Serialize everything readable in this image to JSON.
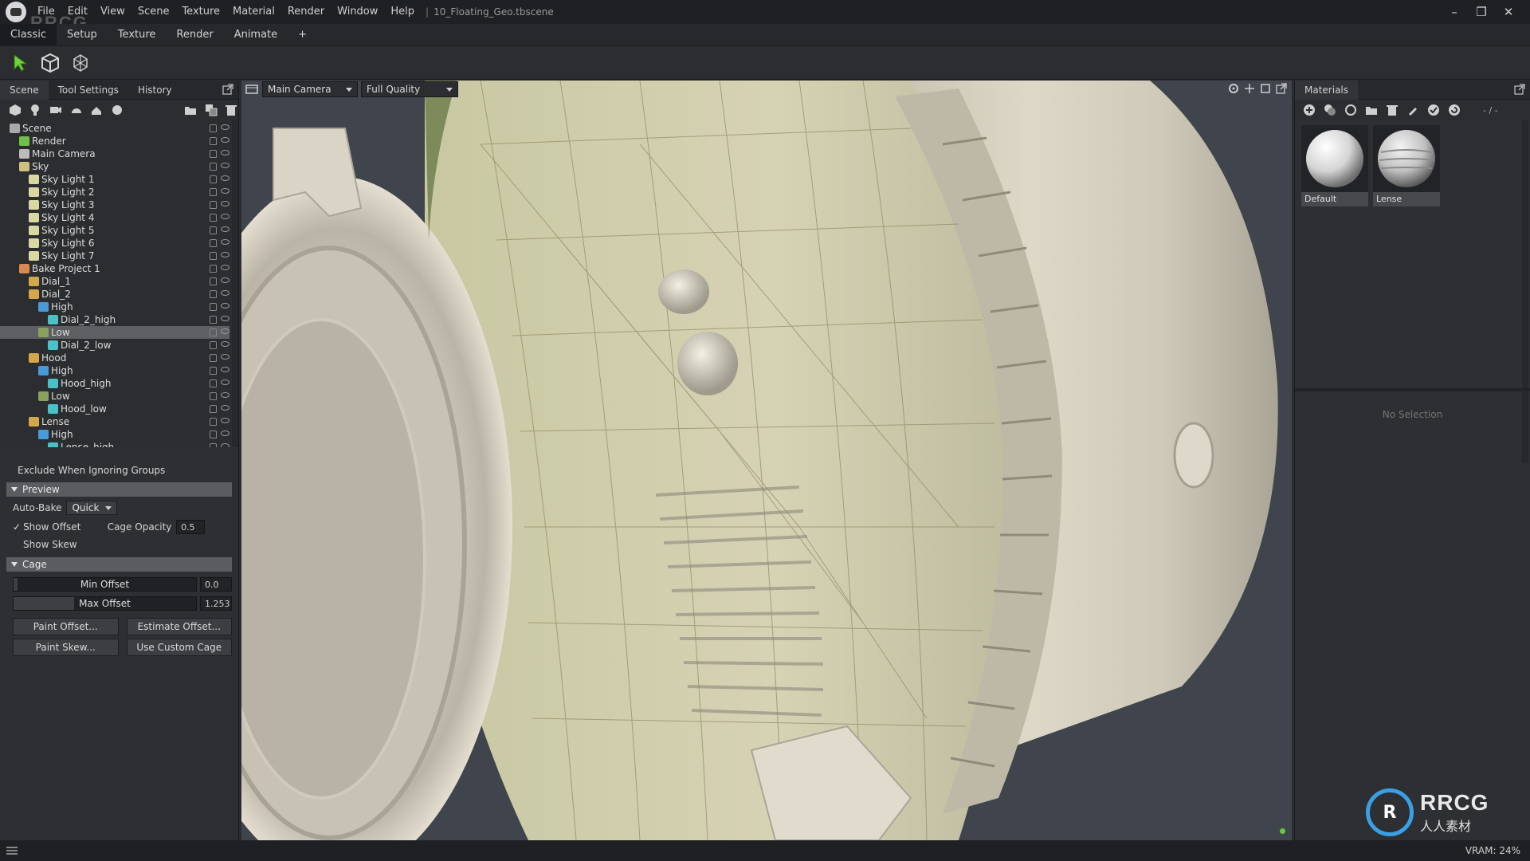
{
  "app": {
    "menu": [
      "File",
      "Edit",
      "View",
      "Scene",
      "Texture",
      "Material",
      "Render",
      "Window",
      "Help"
    ],
    "document_title": "10_Floating_Geo.tbscene",
    "separator": "|"
  },
  "workspace_tabs": [
    "Classic",
    "Setup",
    "Texture",
    "Render",
    "Animate",
    "+"
  ],
  "left_panel": {
    "tabs": [
      "Scene",
      "Tool Settings",
      "History"
    ],
    "tree": [
      {
        "label": "Scene",
        "depth": 0,
        "icon": "scene-icon",
        "color": "#aaaaaa"
      },
      {
        "label": "Render",
        "depth": 1,
        "icon": "render-icon",
        "color": "#6fbf4a"
      },
      {
        "label": "Main Camera",
        "depth": 1,
        "icon": "camera-icon",
        "color": "#bbbbbb"
      },
      {
        "label": "Sky",
        "depth": 1,
        "icon": "sky-icon",
        "color": "#cfc080"
      },
      {
        "label": "Sky Light 1",
        "depth": 2,
        "icon": "light-icon",
        "color": "#d8d8a0"
      },
      {
        "label": "Sky Light 2",
        "depth": 2,
        "icon": "light-icon",
        "color": "#d8d8a0"
      },
      {
        "label": "Sky Light 3",
        "depth": 2,
        "icon": "light-icon",
        "color": "#d8d8a0"
      },
      {
        "label": "Sky Light 4",
        "depth": 2,
        "icon": "light-icon",
        "color": "#d8d8a0"
      },
      {
        "label": "Sky Light 5",
        "depth": 2,
        "icon": "light-icon",
        "color": "#d8d8a0"
      },
      {
        "label": "Sky Light 6",
        "depth": 2,
        "icon": "light-icon",
        "color": "#d8d8a0"
      },
      {
        "label": "Sky Light 7",
        "depth": 2,
        "icon": "light-icon",
        "color": "#d8d8a0"
      },
      {
        "label": "Bake Project 1",
        "depth": 1,
        "icon": "bake-icon",
        "color": "#d88a50"
      },
      {
        "label": "Dial_1",
        "depth": 2,
        "icon": "folder-icon",
        "color": "#d2a84a"
      },
      {
        "label": "Dial_2",
        "depth": 2,
        "icon": "folder-icon",
        "color": "#d2a84a"
      },
      {
        "label": "High",
        "depth": 3,
        "icon": "high-icon",
        "color": "#4a9ad8"
      },
      {
        "label": "Dial_2_high",
        "depth": 4,
        "icon": "mesh-icon",
        "color": "#4ac0c8"
      },
      {
        "label": "Low",
        "depth": 3,
        "icon": "low-icon",
        "color": "#8aa060",
        "selected": true
      },
      {
        "label": "Dial_2_low",
        "depth": 4,
        "icon": "mesh-icon",
        "color": "#4ac0c8"
      },
      {
        "label": "Hood",
        "depth": 2,
        "icon": "folder-icon",
        "color": "#d2a84a"
      },
      {
        "label": "High",
        "depth": 3,
        "icon": "high-icon",
        "color": "#4a9ad8"
      },
      {
        "label": "Hood_high",
        "depth": 4,
        "icon": "mesh-icon",
        "color": "#4ac0c8"
      },
      {
        "label": "Low",
        "depth": 3,
        "icon": "low-icon",
        "color": "#8aa060"
      },
      {
        "label": "Hood_low",
        "depth": 4,
        "icon": "mesh-icon",
        "color": "#4ac0c8"
      },
      {
        "label": "Lense",
        "depth": 2,
        "icon": "folder-icon",
        "color": "#d2a84a"
      },
      {
        "label": "High",
        "depth": 3,
        "icon": "high-icon",
        "color": "#4a9ad8"
      },
      {
        "label": "Lense_high",
        "depth": 4,
        "icon": "mesh-icon",
        "color": "#4ac0c8"
      }
    ],
    "props": {
      "exclude_label": "Exclude When Ignoring Groups",
      "preview_header": "Preview",
      "auto_bake_label": "Auto-Bake",
      "auto_bake_value": "Quick",
      "show_offset_label": "Show Offset",
      "show_offset_checked": true,
      "cage_opacity_label": "Cage Opacity",
      "cage_opacity_value": "0.5",
      "show_skew_label": "Show Skew",
      "cage_header": "Cage",
      "min_offset_label": "Min Offset",
      "min_offset_value": "0.0",
      "min_offset_level": 0.02,
      "max_offset_label": "Max Offset",
      "max_offset_value": "1.253",
      "max_offset_level": 0.33,
      "paint_offset_btn": "Paint Offset...",
      "estimate_offset_btn": "Estimate Offset...",
      "paint_skew_btn": "Paint Skew...",
      "use_custom_cage_btn": "Use Custom Cage"
    }
  },
  "viewport": {
    "camera": "Main Camera",
    "quality": "Full Quality"
  },
  "right_panel": {
    "tab": "Materials",
    "materials": [
      {
        "name": "Default"
      },
      {
        "name": "Lense"
      }
    ],
    "counter": "- / -",
    "no_selection": "No Selection"
  },
  "statusbar": {
    "vram": "VRAM: 24%"
  },
  "watermark": {
    "top_left": "RRCG",
    "logo_main": "RRCG",
    "logo_sub": "人人素材"
  },
  "colors": {
    "accent_selection": "#5d5f63",
    "model_base": "#d5cfbf",
    "wire": "#9a9a6a",
    "status_dot": "#5fcf3a"
  }
}
